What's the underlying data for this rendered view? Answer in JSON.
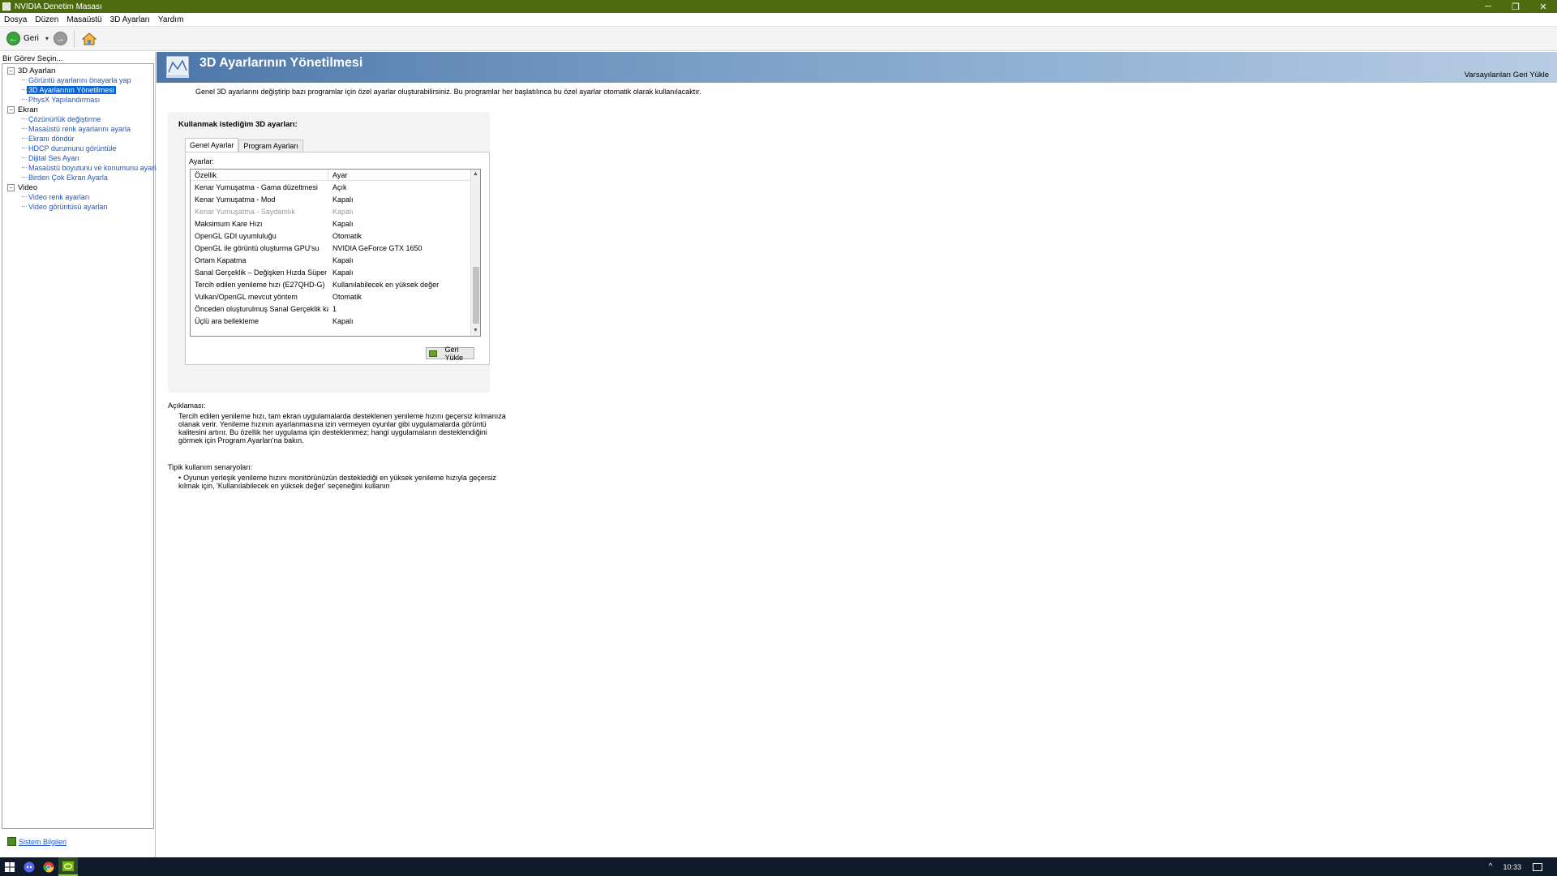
{
  "window": {
    "title": "NVIDIA Denetim Masası",
    "minimize_glyph": "─",
    "restore_glyph": "❐",
    "close_glyph": "✕"
  },
  "menu": [
    "Dosya",
    "Düzen",
    "Masaüstü",
    "3D Ayarları",
    "Yardım"
  ],
  "toolbar": {
    "back_label": "Geri",
    "back_glyph": "←",
    "forward_glyph": "→",
    "dropdown_glyph": "▾"
  },
  "left_panel": {
    "header": "Bir Görev Seçin...",
    "toggle_glyph": "−",
    "tree": [
      {
        "label": "3D Ayarları",
        "children": [
          {
            "label": "Görüntü ayarlarını önayarla yap",
            "selected": false
          },
          {
            "label": "3D Ayarlarının Yönetilmesi",
            "selected": true
          },
          {
            "label": "PhysX Yapılandırması",
            "selected": false
          }
        ]
      },
      {
        "label": "Ekran",
        "children": [
          {
            "label": "Çözünürlük değiştirme"
          },
          {
            "label": "Masaüstü renk ayarlarını ayarla"
          },
          {
            "label": "Ekranı döndür"
          },
          {
            "label": "HDCP durumunu görüntüle"
          },
          {
            "label": "Dijital Ses Ayarı"
          },
          {
            "label": "Masaüstü boyutunu ve konumunu ayarla"
          },
          {
            "label": "Birden Çok Ekran Ayarla"
          }
        ]
      },
      {
        "label": "Video",
        "children": [
          {
            "label": "Video renk ayarları"
          },
          {
            "label": "Video görüntüsü ayarları"
          }
        ]
      }
    ],
    "system_info_link": "Sistem Bilgileri"
  },
  "content": {
    "title": "3D Ayarlarının Yönetilmesi",
    "restore_defaults": "Varsayılanları Geri Yükle",
    "description": "Genel 3D ayarlarını değiştirip bazı programlar için özel ayarlar oluşturabilirsiniz. Bu programlar her başlatılınca bu özel ayarlar otomatik olarak kullanılacaktır.",
    "settings_title": "Kullanmak istediğim 3D ayarları:",
    "tabs": [
      {
        "label": "Genel Ayarlar",
        "active": true
      },
      {
        "label": "Program Ayarları",
        "active": false
      }
    ],
    "settings_label": "Ayarlar:",
    "columns": {
      "property": "Özellik",
      "value": "Ayar"
    },
    "rows": [
      {
        "property": "Kenar Yumuşatma - Gama düzeltmesi",
        "value": "Açık",
        "disabled": false
      },
      {
        "property": "Kenar Yumuşatma - Mod",
        "value": "Kapalı",
        "disabled": false
      },
      {
        "property": "Kenar Yumuşatma - Saydamlık",
        "value": "Kapalı",
        "disabled": true
      },
      {
        "property": "Maksimum Kare Hızı",
        "value": "Kapalı",
        "disabled": false
      },
      {
        "property": "OpenGL GDI uyumluluğu",
        "value": "Otomatik",
        "disabled": false
      },
      {
        "property": "OpenGL ile görüntü oluşturma GPU'su",
        "value": "NVIDIA GeForce GTX 1650",
        "disabled": false
      },
      {
        "property": "Ortam Kapatma",
        "value": "Kapalı",
        "disabled": false
      },
      {
        "property": "Sanal Gerçeklik – Değişken Hızda Süper Ör...",
        "value": "Kapalı",
        "disabled": false
      },
      {
        "property": "Tercih edilen yenileme hızı (E27QHD-G)",
        "value": "Kullanılabilecek en yüksek değer",
        "disabled": false
      },
      {
        "property": "Vulkan/OpenGL mevcut yöntem",
        "value": "Otomatik",
        "disabled": false
      },
      {
        "property": "Önceden oluşturulmuş Sanal Gerçeklik kar...",
        "value": "1",
        "disabled": false
      },
      {
        "property": "Üçlü ara bellekleme",
        "value": "Kapalı",
        "disabled": false
      }
    ],
    "scroll_up_glyph": "▲",
    "scroll_down_glyph": "▼",
    "restore_button": "Geri Yükle",
    "description_label": "Açıklaması:",
    "description_text": "Tercih edilen yenileme hızı, tam ekran uygulamalarda desteklenen yenileme hızını geçersiz kılmanıza olanak verir. Yenileme hızının ayarlanmasına izin vermeyen oyunlar gibi uygulamalarda görüntü kalitesini artırır. Bu özellik her uygulama için desteklenmez; hangi uygulamaların desteklendiğini görmek için Program Ayarları'na bakın.",
    "usage_label": "Tipik kullanım senaryoları:",
    "usage_bullet": "•",
    "usage_item": "Oyunun yerleşik yenileme hızını monitörünüzün desteklediği en yüksek yenileme hızıyla geçersiz kılmak için, 'Kullanılabilecek en yüksek değer' seçeneğini kullanın"
  },
  "taskbar": {
    "clock": "10:33",
    "chevron_glyph": "^"
  },
  "colors": {
    "title_bar": "#4d6b0f",
    "link": "#1a56c9",
    "selection": "#0a64d4",
    "taskbar": "#0f1a2a"
  }
}
